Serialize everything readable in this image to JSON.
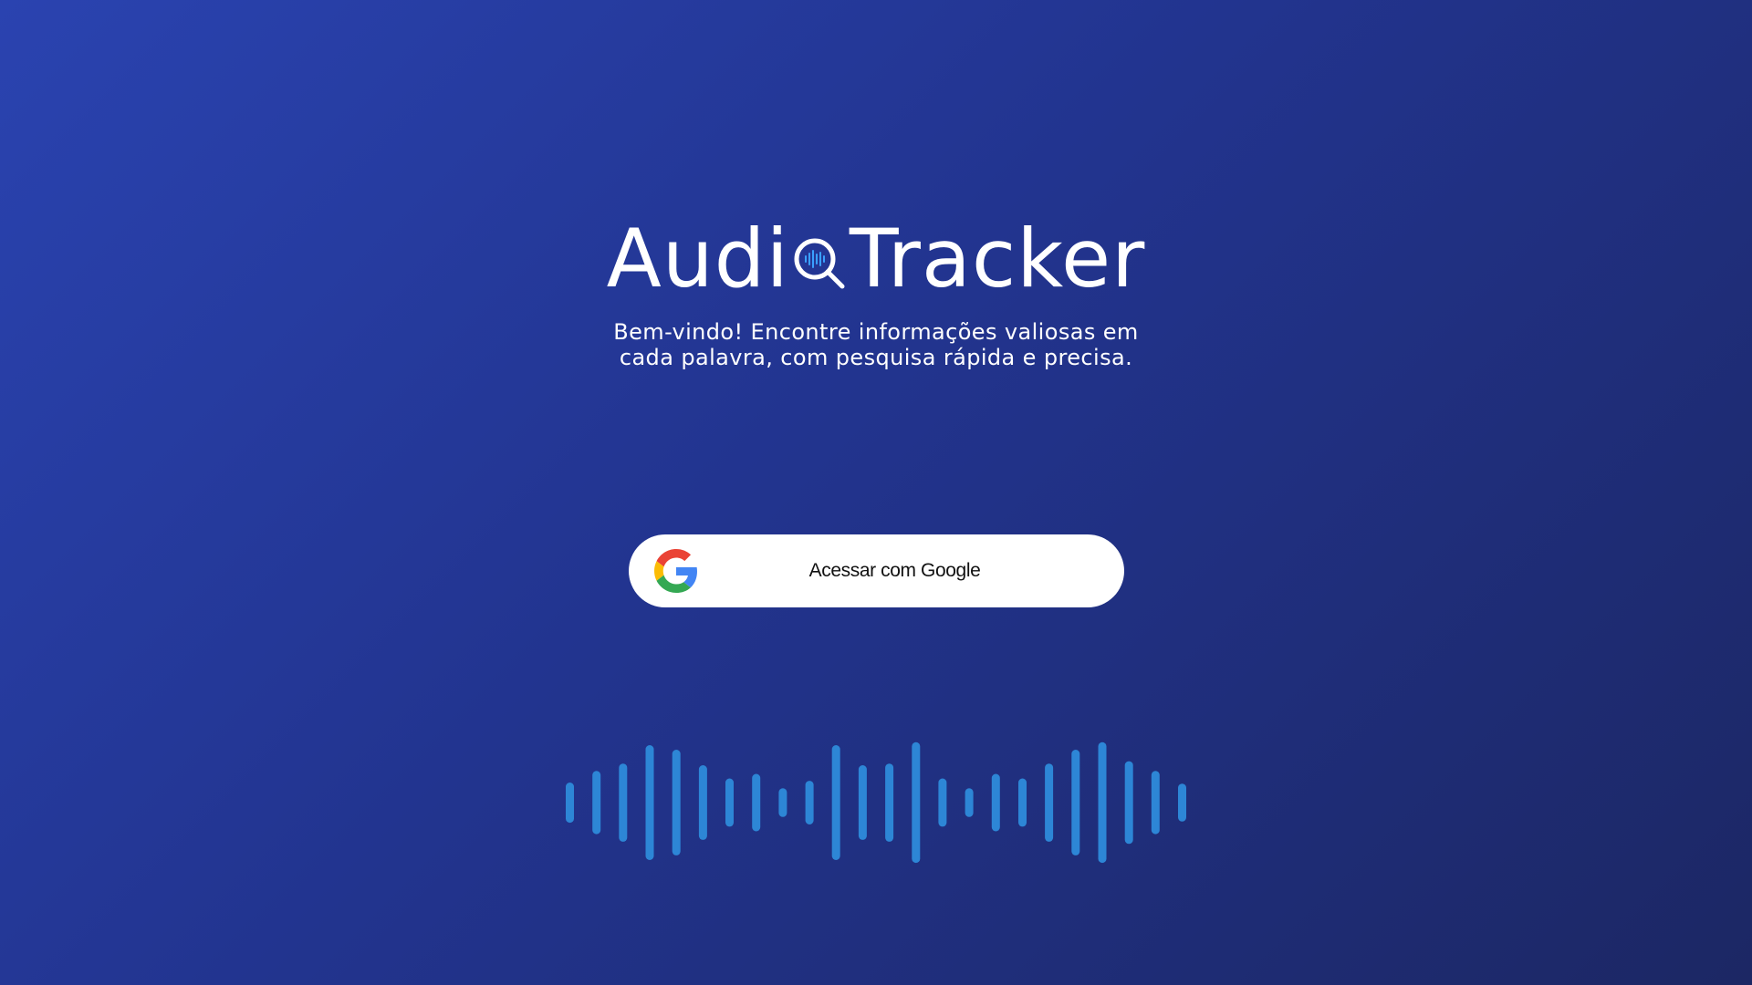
{
  "brand": {
    "name_part1": "Audi",
    "name_part2": "Tracker",
    "logo_icon": "magnifier-soundwave-icon"
  },
  "welcome": {
    "line1": "Bem-vindo! Encontre informações valiosas em",
    "line2": "cada palavra, com pesquisa rápida e precisa."
  },
  "login": {
    "label": "Acessar com Google",
    "icon": "google-icon"
  },
  "waveform": {
    "color": "#2d86d6",
    "bar_levels": [
      0.35,
      0.55,
      0.68,
      1.0,
      0.92,
      0.65,
      0.42,
      0.5,
      0.25,
      0.38,
      1.0,
      0.65,
      0.68,
      1.05,
      0.42,
      0.25,
      0.5,
      0.42,
      0.68,
      0.92,
      1.05,
      0.72,
      0.55,
      0.33
    ]
  },
  "colors": {
    "background_start": "#2a43b0",
    "background_end": "#1c2764",
    "button_bg": "#ffffff"
  }
}
